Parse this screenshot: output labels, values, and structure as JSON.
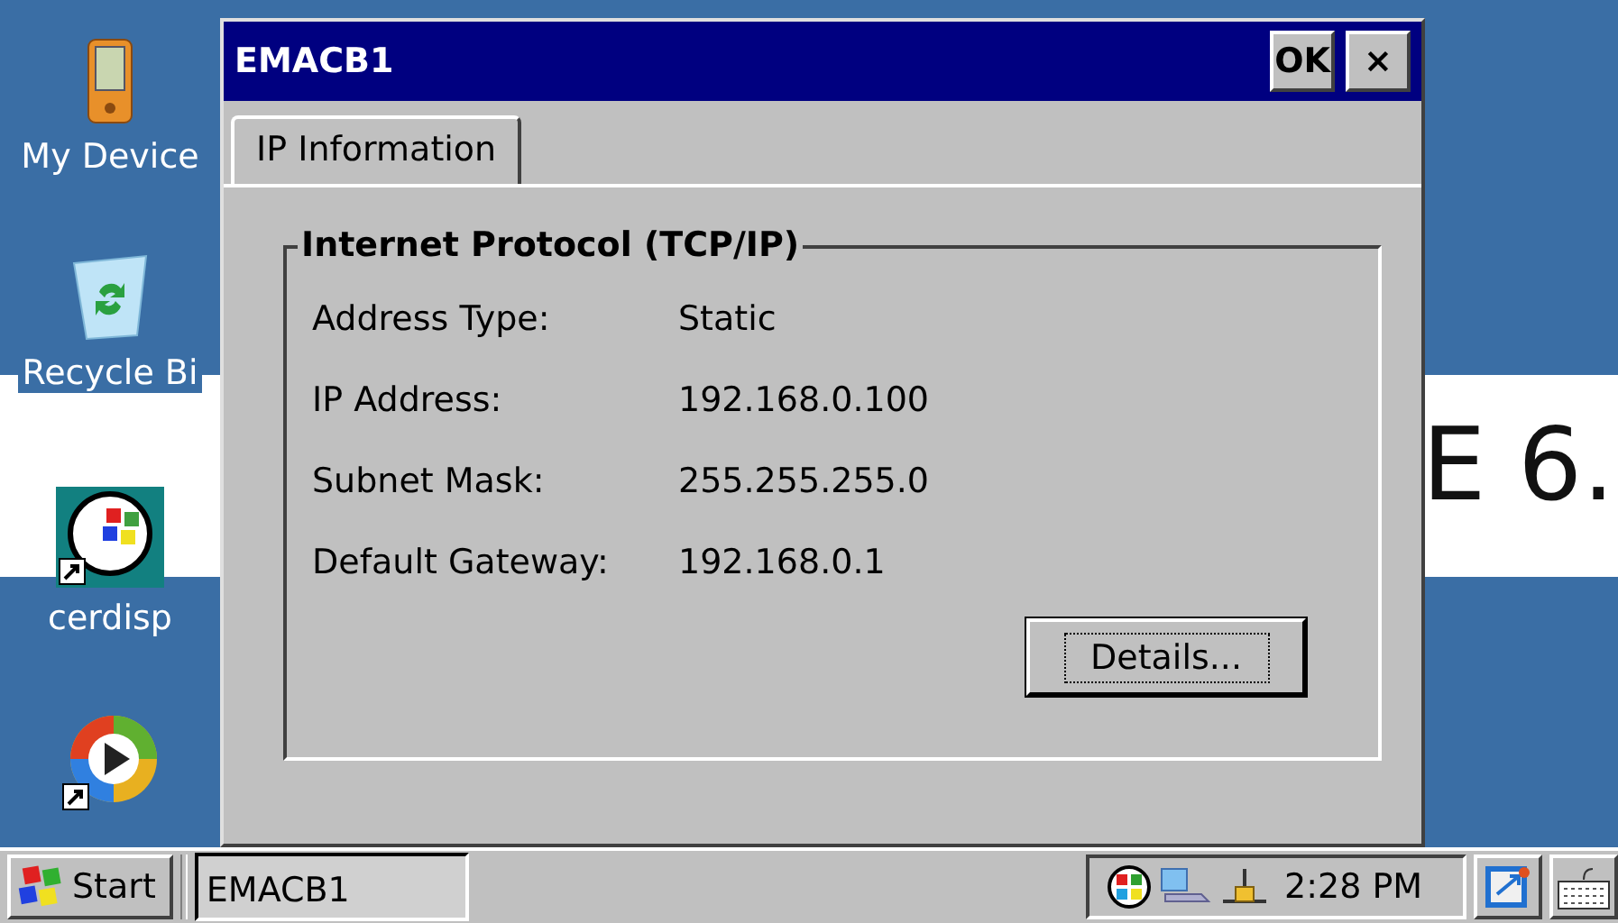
{
  "desktop": {
    "icons": [
      {
        "kind": "device",
        "label": "My Device"
      },
      {
        "kind": "recycle",
        "label": "Recycle Bi"
      },
      {
        "kind": "display",
        "label": "cerdisp"
      },
      {
        "kind": "media"
      }
    ],
    "wallpaper_text": "E 6."
  },
  "window": {
    "title": "EMACB1",
    "ok_button": "OK",
    "close_button": "×"
  },
  "tabs": [
    {
      "label": "IP Information",
      "selected": true
    }
  ],
  "group": {
    "title": "Internet Protocol (TCP/IP)",
    "rows": [
      {
        "label": "Address Type:",
        "value": "Static"
      },
      {
        "label": "IP Address:",
        "value": "192.168.0.100"
      },
      {
        "label": "Subnet Mask:",
        "value": "255.255.255.0"
      },
      {
        "label": "Default Gateway:",
        "value": "192.168.0.1"
      }
    ],
    "details_button": "Details..."
  },
  "taskbar": {
    "start": "Start",
    "tasks": [
      {
        "label": "EMACB1",
        "selected": true
      }
    ],
    "clock": "2:28 PM"
  }
}
